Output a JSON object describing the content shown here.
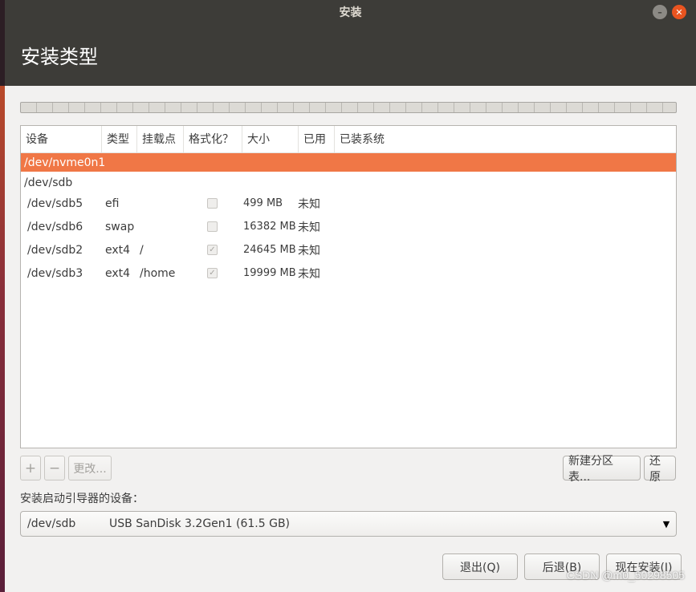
{
  "window": {
    "title": "安装"
  },
  "header": {
    "title": "安装类型"
  },
  "table": {
    "columns": [
      "设备",
      "类型",
      "挂载点",
      "格式化？",
      "大小",
      "已用",
      "已装系统"
    ],
    "disks": [
      "/dev/nvme0n1",
      "/dev/sdb"
    ],
    "partitions": [
      {
        "device": "/dev/sdb5",
        "type": "efi",
        "mount": "",
        "format": false,
        "size": "499 MB",
        "used": "未知",
        "system": ""
      },
      {
        "device": "/dev/sdb6",
        "type": "swap",
        "mount": "",
        "format": false,
        "size": "16382 MB",
        "used": "未知",
        "system": ""
      },
      {
        "device": "/dev/sdb2",
        "type": "ext4",
        "mount": "/",
        "format": true,
        "size": "24645 MB",
        "used": "未知",
        "system": ""
      },
      {
        "device": "/dev/sdb3",
        "type": "ext4",
        "mount": "/home",
        "format": true,
        "size": "19999 MB",
        "used": "未知",
        "system": ""
      }
    ]
  },
  "toolbar": {
    "add_label": "+",
    "remove_label": "−",
    "change_label": "更改...",
    "new_table_label": "新建分区表...",
    "revert_label": "还原"
  },
  "boot": {
    "label": "安装启动引导器的设备：",
    "device": "/dev/sdb",
    "description": "USB  SanDisk 3.2Gen1 (61.5 GB)"
  },
  "footer": {
    "quit_label": "退出(Q)",
    "back_label": "后退(B)",
    "install_label": "现在安装(I)"
  },
  "watermark": "CSDN @m0_50298505"
}
